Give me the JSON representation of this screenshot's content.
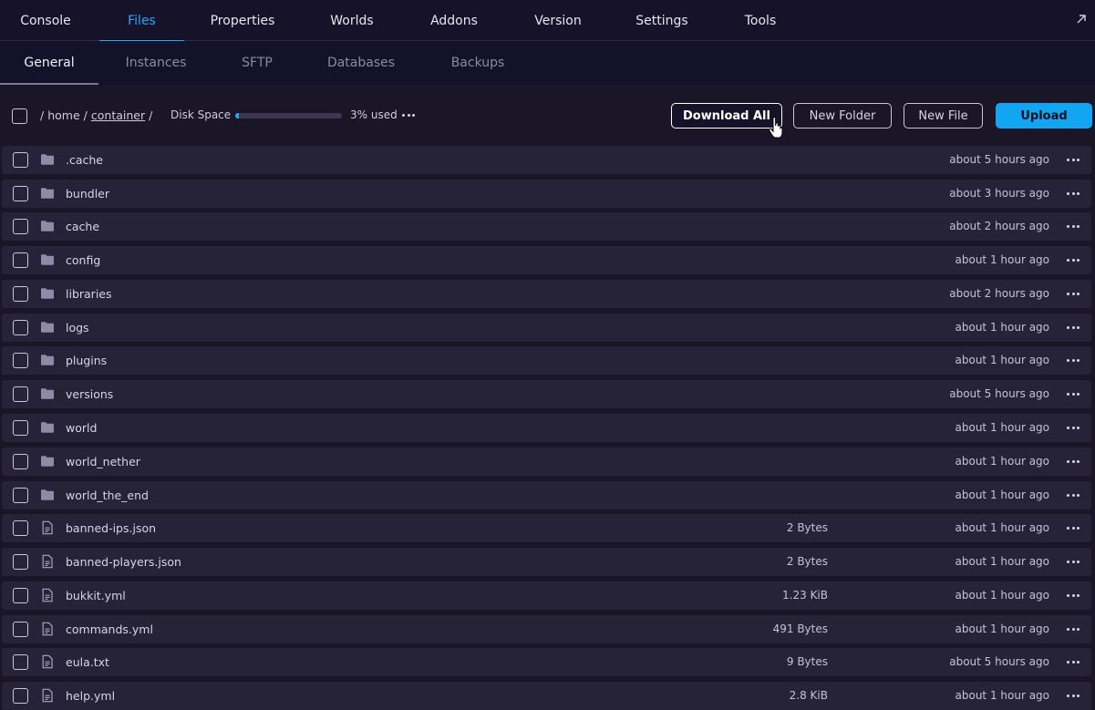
{
  "topnav": {
    "tabs": [
      {
        "label": "Console",
        "active": false
      },
      {
        "label": "Files",
        "active": true
      },
      {
        "label": "Properties",
        "active": false
      },
      {
        "label": "Worlds",
        "active": false
      },
      {
        "label": "Addons",
        "active": false
      },
      {
        "label": "Version",
        "active": false
      },
      {
        "label": "Settings",
        "active": false
      },
      {
        "label": "Tools",
        "active": false
      }
    ],
    "external_icon": "external-link-icon"
  },
  "subnav": {
    "tabs": [
      {
        "label": "General",
        "active": true
      },
      {
        "label": "Instances",
        "active": false
      },
      {
        "label": "SFTP",
        "active": false
      },
      {
        "label": "Databases",
        "active": false
      },
      {
        "label": "Backups",
        "active": false
      }
    ]
  },
  "toolbar": {
    "breadcrumb": {
      "sep": "/",
      "home": "home",
      "container": "container"
    },
    "disk_label": "Disk Space",
    "disk_used_fraction": 0.03,
    "disk_used_text": "3% used",
    "buttons": {
      "download_all": "Download All",
      "new_folder": "New Folder",
      "new_file": "New File",
      "upload": "Upload"
    }
  },
  "colors": {
    "accent": "#27a8f5",
    "upload_button": "#12a6f2",
    "row_bg": "#262238",
    "page_bg": "#1a1628"
  },
  "files": [
    {
      "type": "folder",
      "name": ".cache",
      "size": "",
      "modified": "about 5 hours ago"
    },
    {
      "type": "folder",
      "name": "bundler",
      "size": "",
      "modified": "about 3 hours ago"
    },
    {
      "type": "folder",
      "name": "cache",
      "size": "",
      "modified": "about 2 hours ago"
    },
    {
      "type": "folder",
      "name": "config",
      "size": "",
      "modified": "about 1 hour ago"
    },
    {
      "type": "folder",
      "name": "libraries",
      "size": "",
      "modified": "about 2 hours ago"
    },
    {
      "type": "folder",
      "name": "logs",
      "size": "",
      "modified": "about 1 hour ago"
    },
    {
      "type": "folder",
      "name": "plugins",
      "size": "",
      "modified": "about 1 hour ago"
    },
    {
      "type": "folder",
      "name": "versions",
      "size": "",
      "modified": "about 5 hours ago"
    },
    {
      "type": "folder",
      "name": "world",
      "size": "",
      "modified": "about 1 hour ago"
    },
    {
      "type": "folder",
      "name": "world_nether",
      "size": "",
      "modified": "about 1 hour ago"
    },
    {
      "type": "folder",
      "name": "world_the_end",
      "size": "",
      "modified": "about 1 hour ago"
    },
    {
      "type": "file",
      "name": "banned-ips.json",
      "size": "2 Bytes",
      "modified": "about 1 hour ago"
    },
    {
      "type": "file",
      "name": "banned-players.json",
      "size": "2 Bytes",
      "modified": "about 1 hour ago"
    },
    {
      "type": "file",
      "name": "bukkit.yml",
      "size": "1.23 KiB",
      "modified": "about 1 hour ago"
    },
    {
      "type": "file",
      "name": "commands.yml",
      "size": "491 Bytes",
      "modified": "about 1 hour ago"
    },
    {
      "type": "file",
      "name": "eula.txt",
      "size": "9 Bytes",
      "modified": "about 5 hours ago"
    },
    {
      "type": "file",
      "name": "help.yml",
      "size": "2.8 KiB",
      "modified": "about 1 hour ago"
    }
  ]
}
